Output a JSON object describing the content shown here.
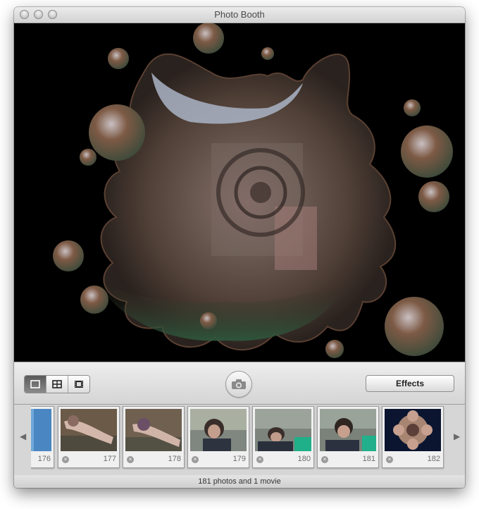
{
  "window": {
    "title": "Photo Booth"
  },
  "toolbar": {
    "view_modes": [
      "single-view",
      "grid-view",
      "movie-view"
    ],
    "effects_label": "Effects"
  },
  "thumbnails": [
    {
      "number": "176",
      "kind": "partial"
    },
    {
      "number": "177",
      "kind": "arm"
    },
    {
      "number": "178",
      "kind": "arm"
    },
    {
      "number": "179",
      "kind": "couch-person"
    },
    {
      "number": "180",
      "kind": "couch-person"
    },
    {
      "number": "181",
      "kind": "couch-person"
    },
    {
      "number": "182",
      "kind": "kaleidoscope"
    }
  ],
  "status": {
    "text": "181 photos and 1 movie"
  }
}
